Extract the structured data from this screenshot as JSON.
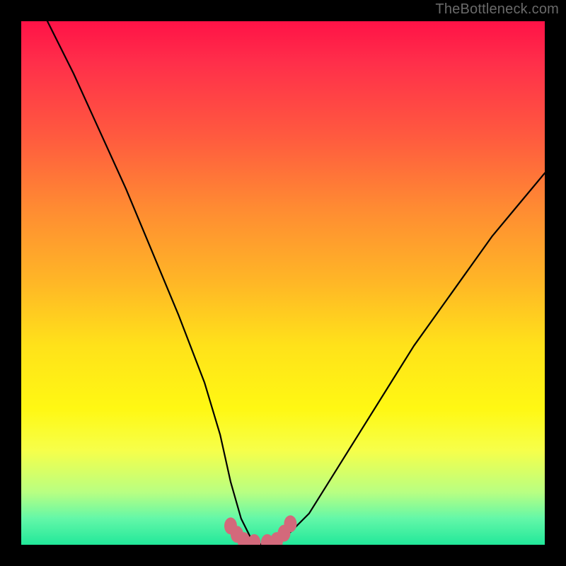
{
  "watermark": "TheBottleneck.com",
  "chart_data": {
    "type": "line",
    "title": "",
    "xlabel": "",
    "ylabel": "",
    "xlim": [
      0,
      100
    ],
    "ylim": [
      0,
      100
    ],
    "series": [
      {
        "name": "bottleneck-curve",
        "x": [
          5,
          10,
          15,
          20,
          25,
          30,
          35,
          38,
          40,
          42,
          44,
          46,
          48,
          50,
          55,
          60,
          65,
          70,
          75,
          80,
          85,
          90,
          95,
          100
        ],
        "values": [
          100,
          90,
          79,
          68,
          56,
          44,
          31,
          21,
          12,
          5,
          1,
          0,
          0,
          1,
          6,
          14,
          22,
          30,
          38,
          45,
          52,
          59,
          65,
          71
        ]
      }
    ],
    "markers": {
      "name": "lowest-bottleneck-range",
      "x": [
        40.0,
        41.2,
        42.5,
        44.5,
        47.0,
        48.8,
        50.2,
        51.4
      ],
      "values": [
        3.6,
        2.0,
        0.8,
        0.4,
        0.4,
        0.8,
        2.2,
        4.0
      ]
    },
    "colors": {
      "curve": "#000000",
      "marker": "#d3697b",
      "gradient_top": "#ff1247",
      "gradient_bottom": "#22e89a"
    }
  }
}
